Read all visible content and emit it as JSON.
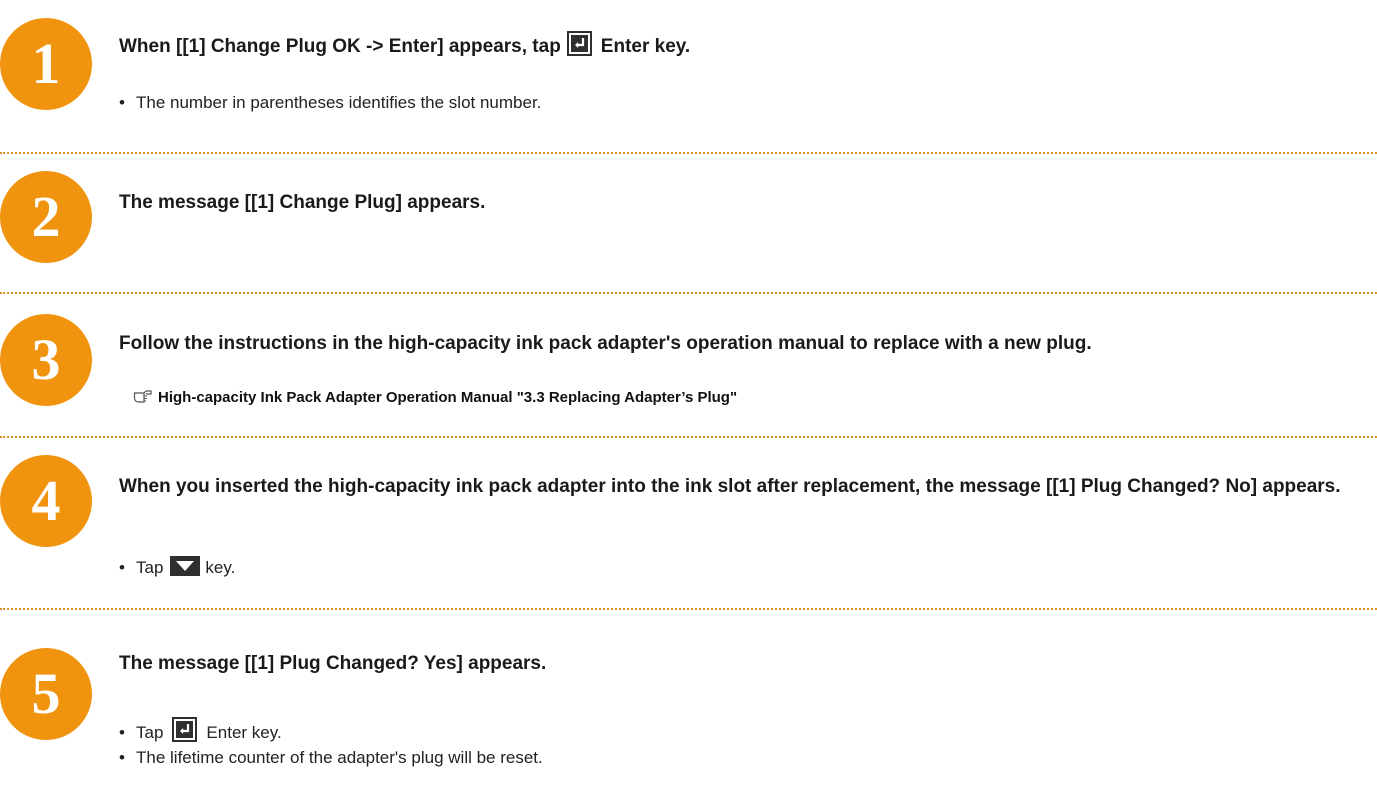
{
  "steps": [
    {
      "number": "1",
      "title_before": "When [[1] Change Plug  OK -> Enter] appears, tap",
      "title_after": "Enter key.",
      "notes": [
        "The number in parentheses identifies the slot number."
      ]
    },
    {
      "number": "2",
      "title": "The message [[1] Change Plug] appears."
    },
    {
      "number": "3",
      "title": "Follow the instructions in the high-capacity ink pack adapter's operation manual to replace with a new plug.",
      "reference": "High-capacity Ink Pack Adapter Operation Manual \"3.3 Replacing Adapter’s Plug\""
    },
    {
      "number": "4",
      "title": "When you inserted the high-capacity ink pack adapter into the ink slot after replacement, the message [[1] Plug Changed? No] appears.",
      "note_before": "Tap",
      "note_after": "key."
    },
    {
      "number": "5",
      "title": "The message [[1] Plug Changed? Yes] appears.",
      "note1_before": "Tap",
      "note1_after": "Enter key.",
      "note2": "The lifetime counter of the adapter's plug will be reset."
    }
  ],
  "colors": {
    "accent": "#f0940f",
    "divider": "#e0922a",
    "key": "#2f2f2f"
  },
  "icons": {
    "enter_key": "enter-key-icon",
    "down_key": "down-arrow-key-icon",
    "reference": "pointing-hand-icon"
  }
}
